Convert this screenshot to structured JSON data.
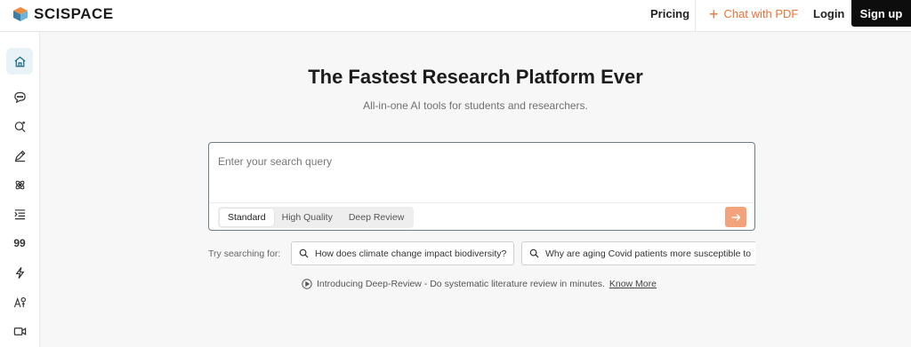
{
  "header": {
    "brand": "SCISPACE",
    "nav": {
      "pricing": "Pricing",
      "chat_with_pdf": "Chat with PDF",
      "login": "Login",
      "signup": "Sign up"
    }
  },
  "sidebar": {
    "items": [
      {
        "name": "home",
        "icon": "home-icon",
        "active": true
      },
      {
        "name": "chat",
        "icon": "chat-bubble-icon"
      },
      {
        "name": "search",
        "icon": "search-sparkle-icon"
      },
      {
        "name": "write",
        "icon": "pen-icon"
      },
      {
        "name": "extract",
        "icon": "atom-icon"
      },
      {
        "name": "outline",
        "icon": "list-icon"
      },
      {
        "name": "citation",
        "icon": "quote-icon",
        "text": "99"
      },
      {
        "name": "paraphrase",
        "icon": "lightning-icon"
      },
      {
        "name": "ai-detector",
        "icon": "ai-detect-icon"
      },
      {
        "name": "video",
        "icon": "video-icon"
      }
    ]
  },
  "main": {
    "title": "The Fastest Research Platform Ever",
    "subtitle": "All-in-one AI tools for students and researchers.",
    "search": {
      "placeholder": "Enter your search query",
      "value": "",
      "modes": [
        "Standard",
        "High Quality",
        "Deep Review"
      ],
      "selected_mode": "Standard"
    },
    "try_label": "Try searching for:",
    "suggestions": [
      "How does climate change impact biodiversity?",
      "Why are aging Covid patients more susceptible to"
    ],
    "intro_text": "Introducing Deep-Review - Do systematic literature review in minutes.",
    "intro_link": "Know More"
  },
  "colors": {
    "accent": "#e8743a",
    "submit": "#f4a27b",
    "active_nav_bg": "#e9f3f7"
  }
}
